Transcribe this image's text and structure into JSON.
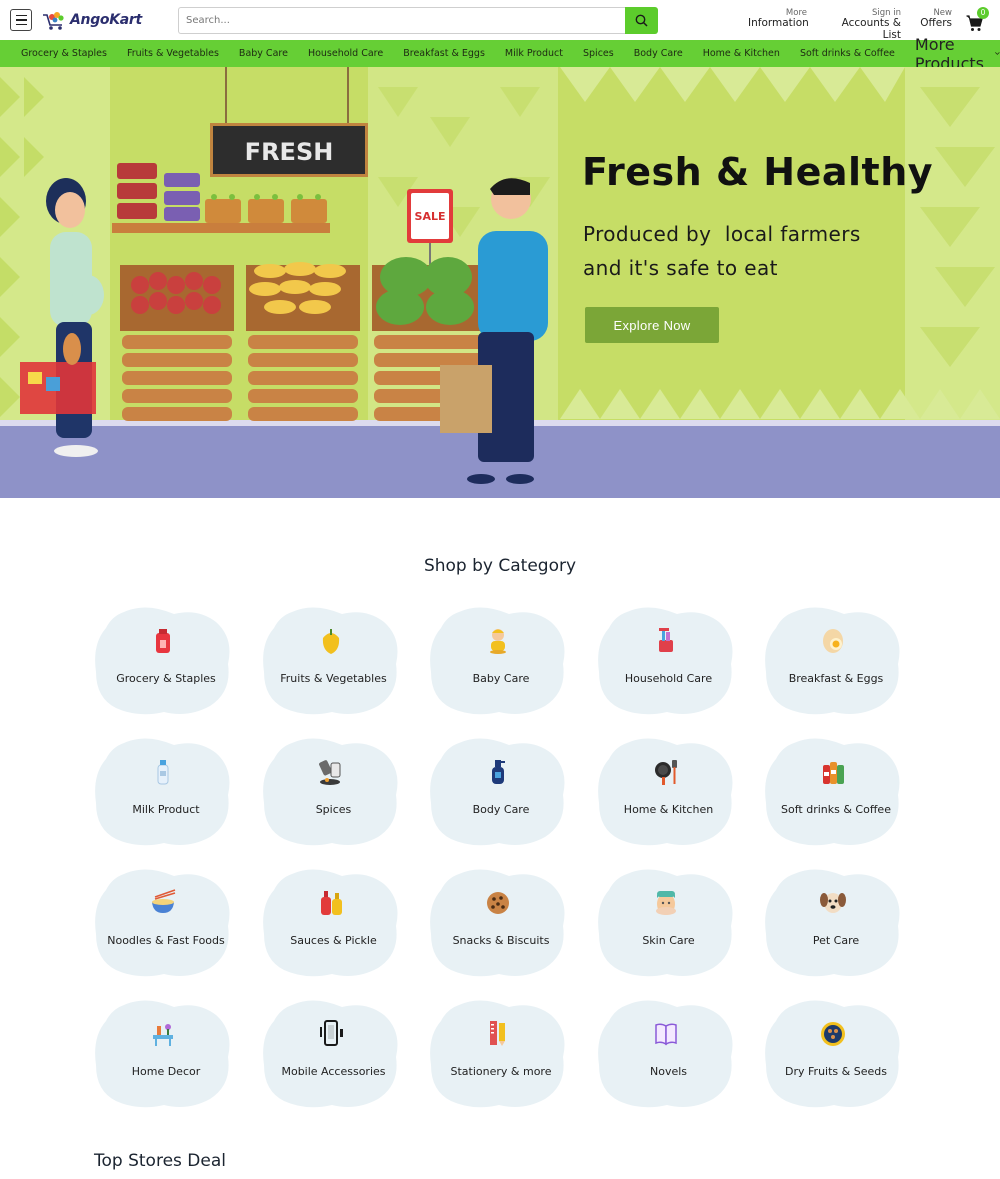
{
  "header": {
    "logo_text": "AngoKart",
    "search_placeholder": "Search...",
    "more_small": "More",
    "more_big": "Information",
    "signin_small": "Sign in",
    "signin_big": "Accounts & List",
    "new_small": "New",
    "new_big": "Offers",
    "cart_count": "0"
  },
  "nav": {
    "items": [
      "Grocery & Staples",
      "Fruits & Vegetables",
      "Baby Care",
      "Household Care",
      "Breakfast & Eggs",
      "Milk Product",
      "Spices",
      "Body Care",
      "Home & Kitchen",
      "Soft drinks & Coffee"
    ],
    "more_label": "More Products"
  },
  "hero": {
    "title": "Fresh & Healthy",
    "subtitle_line1": "Produced by  local farmers",
    "subtitle_line2": "and it's safe to eat",
    "cta": "Explore Now",
    "sign_text": "FRESH",
    "sale_text": "SALE"
  },
  "categories": {
    "title": "Shop by Category",
    "items": [
      {
        "label": "Grocery & Staples",
        "icon": "oil-bottle-icon"
      },
      {
        "label": "Fruits & Vegetables",
        "icon": "bell-pepper-icon"
      },
      {
        "label": "Baby Care",
        "icon": "baby-icon"
      },
      {
        "label": "Household Care",
        "icon": "cleaning-bucket-icon"
      },
      {
        "label": "Breakfast & Eggs",
        "icon": "egg-icon"
      },
      {
        "label": "Milk Product",
        "icon": "milk-bottle-icon"
      },
      {
        "label": "Spices",
        "icon": "spice-jars-icon"
      },
      {
        "label": "Body Care",
        "icon": "lotion-bottle-icon"
      },
      {
        "label": "Home & Kitchen",
        "icon": "pan-spatula-icon"
      },
      {
        "label": "Soft drinks & Coffee",
        "icon": "soda-bottles-icon"
      },
      {
        "label": "Noodles & Fast Foods",
        "icon": "noodle-bowl-icon"
      },
      {
        "label": "Sauces & Pickle",
        "icon": "sauce-bottles-icon"
      },
      {
        "label": "Snacks & Biscuits",
        "icon": "cookie-icon"
      },
      {
        "label": "Skin Care",
        "icon": "face-mask-icon"
      },
      {
        "label": "Pet Care",
        "icon": "dog-icon"
      },
      {
        "label": "Home Decor",
        "icon": "table-decor-icon"
      },
      {
        "label": "Mobile Accessories",
        "icon": "mobile-phone-icon"
      },
      {
        "label": "Stationery & more",
        "icon": "pencil-ruler-icon"
      },
      {
        "label": "Novels",
        "icon": "open-book-icon"
      },
      {
        "label": "Dry Fruits & Seeds",
        "icon": "nut-bowl-icon"
      }
    ]
  },
  "stores": {
    "title": "Top Stores Deal"
  },
  "colors": {
    "brand_green": "#5ccc2c",
    "nav_green": "#66cf35",
    "hero_bg": "#c6dd66",
    "cta_green": "#7ba637",
    "tile_bg": "#e8f1f5"
  }
}
